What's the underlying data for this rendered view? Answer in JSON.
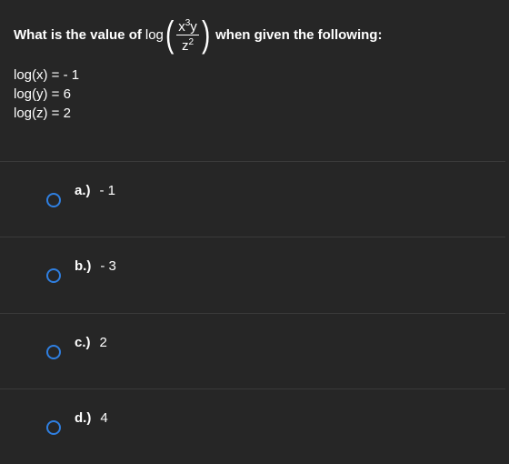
{
  "question": {
    "prefix": "What is the value of",
    "log": "log",
    "numerator_x": "x",
    "numerator_x_exp": "3",
    "numerator_y": "y",
    "denominator_z": "z",
    "denominator_z_exp": "2",
    "suffix": "when given the following:"
  },
  "givens": [
    "log(x) = - 1",
    "log(y) = 6",
    "log(z) = 2"
  ],
  "options": [
    {
      "letter": "a.)",
      "value": "- 1"
    },
    {
      "letter": "b.)",
      "value": "- 3"
    },
    {
      "letter": "c.)",
      "value": "2"
    },
    {
      "letter": "d.)",
      "value": "4"
    }
  ],
  "colors": {
    "background": "#262626",
    "radio": "#2f7fe0",
    "divider": "#3a3a3a"
  }
}
